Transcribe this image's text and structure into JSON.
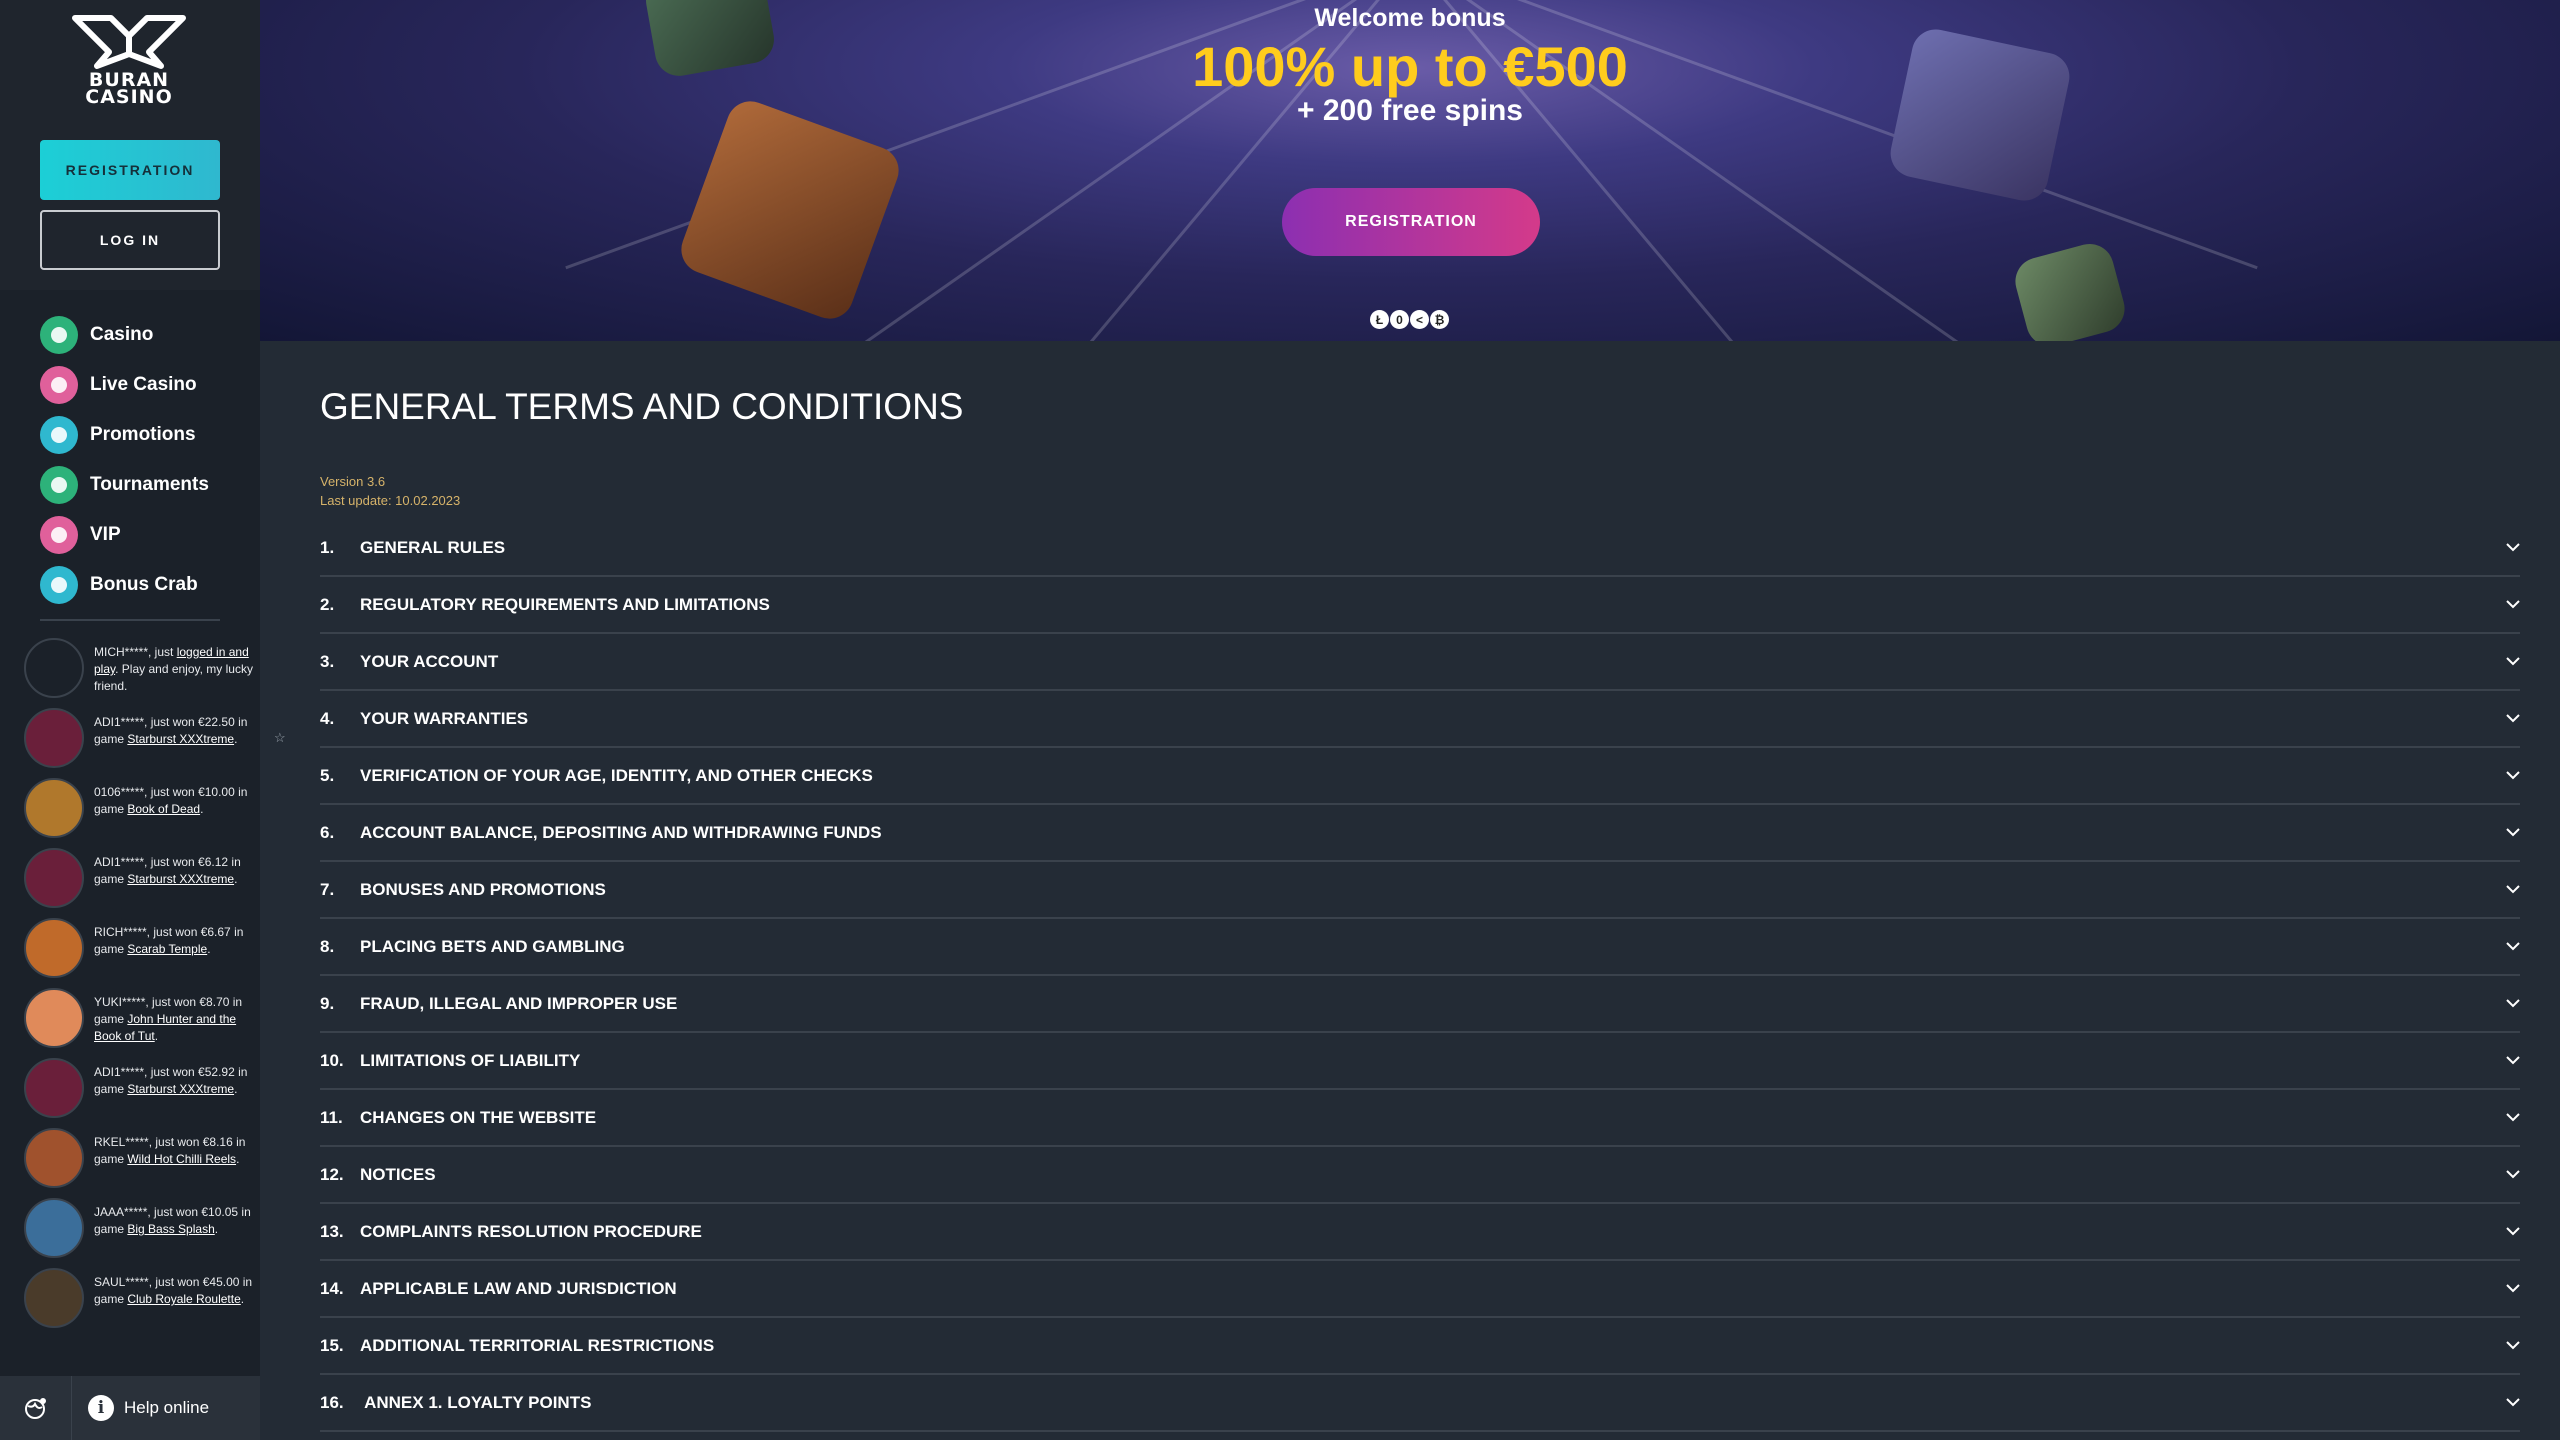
{
  "brand": {
    "name_line1": "BURAN",
    "name_line2": "CASINO"
  },
  "auth": {
    "registration_label": "REGISTRATION",
    "login_label": "LOG IN"
  },
  "nav": [
    {
      "label": "Casino",
      "icon": "casino-icon",
      "color": "#2db27a"
    },
    {
      "label": "Live Casino",
      "icon": "live-casino-icon",
      "color": "#e0609b"
    },
    {
      "label": "Promotions",
      "icon": "gift-icon",
      "color": "#2fb8cf"
    },
    {
      "label": "Tournaments",
      "icon": "trophy-icon",
      "color": "#2db27a"
    },
    {
      "label": "VIP",
      "icon": "diamond-icon",
      "color": "#e0609b"
    },
    {
      "label": "Bonus Crab",
      "icon": "crab-icon",
      "color": "#2fb8cf"
    }
  ],
  "feed": [
    {
      "pre": "MICH*****, just ",
      "link": "logged in and play",
      "post": ". Play and enjoy, my lucky friend.",
      "thumb": "buran-logo"
    },
    {
      "pre": "ADI1*****, just won €22.50 in game ",
      "link": "Starburst XXXtreme",
      "post": ".",
      "thumb": "starburst"
    },
    {
      "pre": "0106*****, just won €10.00 in game ",
      "link": "Book of Dead",
      "post": ".",
      "thumb": "book-of-dead"
    },
    {
      "pre": "ADI1*****, just won €6.12 in game ",
      "link": "Starburst XXXtreme",
      "post": ".",
      "thumb": "starburst"
    },
    {
      "pre": "RICH*****, just won €6.67 in game ",
      "link": "Scarab Temple",
      "post": ".",
      "thumb": "scarab-temple"
    },
    {
      "pre": "YUKI*****, just won €8.70 in game ",
      "link": "John Hunter and the Book of Tut",
      "post": ".",
      "thumb": "john-hunter"
    },
    {
      "pre": "ADI1*****, just won €52.92 in game ",
      "link": "Starburst XXXtreme",
      "post": ".",
      "thumb": "starburst"
    },
    {
      "pre": "RKEL*****, just won €8.16 in game ",
      "link": "Wild Hot Chilli Reels",
      "post": ".",
      "thumb": "wild-hot-chilli"
    },
    {
      "pre": "JAAA*****, just won €10.05 in game ",
      "link": "Big Bass Splash",
      "post": ".",
      "thumb": "big-bass"
    },
    {
      "pre": "SAUL*****, just won €45.00 in game ",
      "link": "Club Royale Roulette",
      "post": ".",
      "thumb": "club-royale"
    }
  ],
  "footer": {
    "help_label": "Help online"
  },
  "banner": {
    "title": "Welcome bonus",
    "amount": "100% up to €500",
    "spins": "+ 200 free spins",
    "cta_label": "REGISTRATION",
    "coins": [
      "Ł",
      "0",
      "<",
      "₿"
    ]
  },
  "page": {
    "title": "GENERAL TERMS AND CONDITIONS",
    "version": "Version 3.6",
    "last_update": "Last update: 10.02.2023"
  },
  "sections": [
    {
      "num": "1.",
      "title": "GENERAL RULES"
    },
    {
      "num": "2.",
      "title": "REGULATORY REQUIREMENTS AND LIMITATIONS"
    },
    {
      "num": "3.",
      "title": "YOUR ACCOUNT"
    },
    {
      "num": "4.",
      "title": "YOUR WARRANTIES"
    },
    {
      "num": "5.",
      "title": "VERIFICATION OF YOUR AGE, IDENTITY, AND OTHER CHECKS"
    },
    {
      "num": "6.",
      "title": "ACCOUNT BALANCE, DEPOSITING AND WITHDRAWING FUNDS"
    },
    {
      "num": "7.",
      "title": "BONUSES AND PROMOTIONS"
    },
    {
      "num": "8.",
      "title": "PLACING BETS AND GAMBLING"
    },
    {
      "num": "9.",
      "title": "FRAUD, ILLEGAL AND IMPROPER USE"
    },
    {
      "num": "10.",
      "title": "LIMITATIONS OF LIABILITY"
    },
    {
      "num": "11.",
      "title": "CHANGES ON THE WEBSITE"
    },
    {
      "num": "12.",
      "title": "NOTICES"
    },
    {
      "num": "13.",
      "title": "COMPLAINTS RESOLUTION PROCEDURE"
    },
    {
      "num": "14.",
      "title": "APPLICABLE LAW AND JURISDICTION"
    },
    {
      "num": "15.",
      "title": "ADDITIONAL TERRITORIAL RESTRICTIONS"
    },
    {
      "num": "16.",
      "title": " ANNEX 1. LOYALTY POINTS"
    }
  ]
}
